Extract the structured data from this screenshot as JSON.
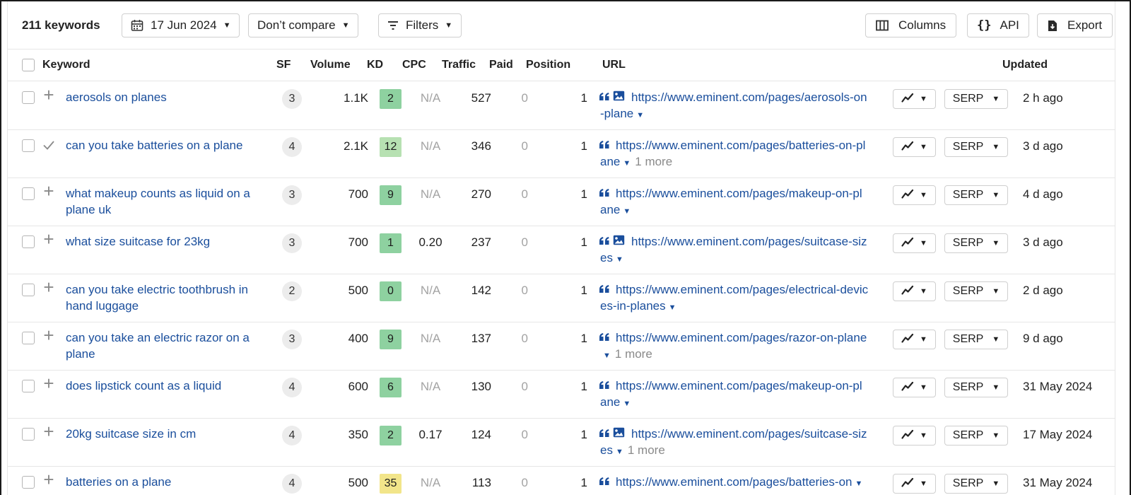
{
  "toolbar": {
    "keyword_count": "211 keywords",
    "date_label": "17 Jun 2024",
    "compare_label": "Don’t compare",
    "filters_label": "Filters",
    "columns_label": "Columns",
    "api_label": "API",
    "export_label": "Export"
  },
  "table": {
    "headers": {
      "keyword": "Keyword",
      "sf": "SF",
      "volume": "Volume",
      "kd": "KD",
      "cpc": "CPC",
      "traffic": "Traffic",
      "paid": "Paid",
      "position": "Position",
      "url": "URL",
      "updated": "Updated"
    },
    "serp_label": "SERP",
    "rows": [
      {
        "keyword": "aerosols on planes",
        "action": "plus",
        "sf": "3",
        "volume": "1.1K",
        "kd": "2",
        "kd_color": "#8ed1a0",
        "cpc": "N/A",
        "traffic": "527",
        "paid": "0",
        "position": "1",
        "image_icon": true,
        "url": "https://www.eminent.com/pages/aerosols-on-plane",
        "more": "",
        "updated": "2 h ago"
      },
      {
        "keyword": "can you take batteries on a plane",
        "action": "check",
        "sf": "4",
        "volume": "2.1K",
        "kd": "12",
        "kd_color": "#b7e1b2",
        "cpc": "N/A",
        "traffic": "346",
        "paid": "0",
        "position": "1",
        "image_icon": false,
        "url": "https://www.eminent.com/pages/batteries-on-plane",
        "more": "1 more",
        "updated": "3 d ago"
      },
      {
        "keyword": "what makeup counts as liquid on a plane uk",
        "action": "plus",
        "sf": "3",
        "volume": "700",
        "kd": "9",
        "kd_color": "#8ed1a0",
        "cpc": "N/A",
        "traffic": "270",
        "paid": "0",
        "position": "1",
        "image_icon": false,
        "url": "https://www.eminent.com/pages/makeup-on-plane",
        "more": "",
        "updated": "4 d ago"
      },
      {
        "keyword": "what size suitcase for 23kg",
        "action": "plus",
        "sf": "3",
        "volume": "700",
        "kd": "1",
        "kd_color": "#8ed1a0",
        "cpc": "0.20",
        "traffic": "237",
        "paid": "0",
        "position": "1",
        "image_icon": true,
        "url": "https://www.eminent.com/pages/suitcase-sizes",
        "more": "",
        "updated": "3 d ago"
      },
      {
        "keyword": "can you take electric toothbrush in hand luggage",
        "action": "plus",
        "sf": "2",
        "volume": "500",
        "kd": "0",
        "kd_color": "#8ed1a0",
        "cpc": "N/A",
        "traffic": "142",
        "paid": "0",
        "position": "1",
        "image_icon": false,
        "url": "https://www.eminent.com/pages/electrical-devices-in-planes",
        "more": "",
        "updated": "2 d ago"
      },
      {
        "keyword": "can you take an electric razor on a plane",
        "action": "plus",
        "sf": "3",
        "volume": "400",
        "kd": "9",
        "kd_color": "#8ed1a0",
        "cpc": "N/A",
        "traffic": "137",
        "paid": "0",
        "position": "1",
        "image_icon": false,
        "url": "https://www.eminent.com/pages/razor-on-plane",
        "more": "1 more",
        "updated": "9 d ago"
      },
      {
        "keyword": "does lipstick count as a liquid",
        "action": "plus",
        "sf": "4",
        "volume": "600",
        "kd": "6",
        "kd_color": "#8ed1a0",
        "cpc": "N/A",
        "traffic": "130",
        "paid": "0",
        "position": "1",
        "image_icon": false,
        "url": "https://www.eminent.com/pages/makeup-on-plane",
        "more": "",
        "updated": "31 May 2024"
      },
      {
        "keyword": "20kg suitcase size in cm",
        "action": "plus",
        "sf": "4",
        "volume": "350",
        "kd": "2",
        "kd_color": "#8ed1a0",
        "cpc": "0.17",
        "traffic": "124",
        "paid": "0",
        "position": "1",
        "image_icon": true,
        "url": "https://www.eminent.com/pages/suitcase-sizes",
        "more": "1 more",
        "updated": "17 May 2024"
      },
      {
        "keyword": "batteries on a plane",
        "action": "plus",
        "sf": "4",
        "volume": "500",
        "kd": "35",
        "kd_color": "#f2e58a",
        "cpc": "N/A",
        "traffic": "113",
        "paid": "0",
        "position": "1",
        "image_icon": false,
        "url": "https://www.eminent.com/pages/batteries-on",
        "more": "",
        "updated": "31 May 2024"
      }
    ]
  }
}
